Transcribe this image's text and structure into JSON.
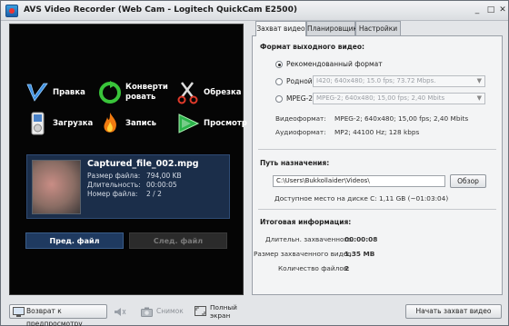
{
  "window": {
    "title": "AVS Video Recorder (Web Cam - Logitech QuickCam E2500)"
  },
  "actions": [
    {
      "label": "Правка",
      "icon": "edit-icon"
    },
    {
      "label": "Конверти\nровать",
      "icon": "convert-icon"
    },
    {
      "label": "Обрезка",
      "icon": "scissors-icon"
    },
    {
      "label": "Загрузка",
      "icon": "ipod-icon"
    },
    {
      "label": "Запись",
      "icon": "burn-icon"
    },
    {
      "label": "Просмотр",
      "icon": "play-icon"
    }
  ],
  "file": {
    "name": "Captured_file_002.mpg",
    "size_label": "Размер файла:",
    "size_value": "794,00 KB",
    "duration_label": "Длительность:",
    "duration_value": "00:00:05",
    "number_label": "Номер файла:",
    "number_value": "2 / 2"
  },
  "nav": {
    "prev": "Пред. файл",
    "next": "След. файл"
  },
  "tabs": [
    "Захват видео",
    "Планировщик",
    "Настройки"
  ],
  "format": {
    "heading": "Формат выходного видео:",
    "options": [
      {
        "label": "Рекомендованный формат",
        "selected": true,
        "combo": ""
      },
      {
        "label": "Родной",
        "selected": false,
        "combo": "I420; 640x480; 15.0 fps; 73.72 Mbps."
      },
      {
        "label": "MPEG-2",
        "selected": false,
        "combo": "MPEG-2; 640x480; 15,00 fps; 2,40 Mbits"
      }
    ],
    "video_label": "Видеоформат:",
    "video_value": "MPEG-2; 640x480; 15,00 fps; 2,40 Mbits",
    "audio_label": "Аудиоформат:",
    "audio_value": "MP2; 44100 Hz; 128 kbps"
  },
  "destination": {
    "heading": "Путь назначения:",
    "path": "C:\\Users\\Bukkollaider\\Videos\\",
    "browse": "Обзор",
    "free_space": "Доступное место на диске C: 1,11 GB (~01:03:04)"
  },
  "summary": {
    "heading": "Итоговая информация:",
    "duration_label": "Длительн. захваченного:",
    "duration_value": "00:00:08",
    "size_label": "Размер захваченного видео:",
    "size_value": "1,35 MB",
    "count_label": "Количество файлов:",
    "count_value": "2"
  },
  "bottom": {
    "back": "Возврат к предпросмотру",
    "snapshot": "Снимок",
    "fullscreen_1": "Полный",
    "fullscreen_2": "экран",
    "start": "Начать захват видео"
  },
  "colors": {
    "panel_bg": "#050505",
    "file_panel": "#1b2e4a",
    "prev_btn": "#1f3a60",
    "next_btn": "#2b2b2b"
  }
}
